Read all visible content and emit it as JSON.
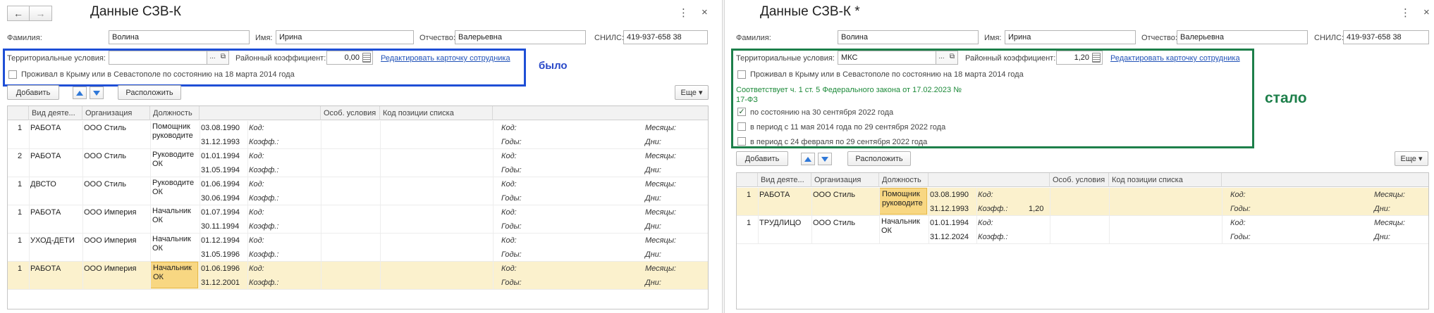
{
  "left": {
    "title": "Данные СЗВ-К",
    "fields": {
      "surname_label": "Фамилия:",
      "surname": "Волина",
      "name_label": "Имя:",
      "name": "Ирина",
      "patronymic_label": "Отчество:",
      "patronymic": "Валерьевна",
      "snils_label": "СНИЛС:",
      "snils": "419-937-658 38"
    },
    "territorial_label": "Территориальные условия:",
    "territorial_value": "",
    "district_label": "Районный коэффициент:",
    "district_value": "0,00",
    "edit_link": "Редактировать карточку сотрудника",
    "crimea_label": "Проживал в Крыму или в Севастополе по состоянию на 18 марта 2014 года",
    "annotation": "было",
    "toolbar": {
      "add": "Добавить",
      "arrange": "Расположить",
      "more": "Еще"
    },
    "columns": [
      "Вид деяте...",
      "Организация",
      "Должность",
      "Особ. условия",
      "Код позиции списка"
    ],
    "rows": [
      {
        "num": "1",
        "kind": "РАБОТА",
        "org": "ООО Стиль",
        "pos": "Помощник руководите",
        "d1": "03.08.1990",
        "d2": "31.12.1993",
        "coef": ""
      },
      {
        "num": "2",
        "kind": "РАБОТА",
        "org": "ООО Стиль",
        "pos": "Руководите ОК",
        "d1": "01.01.1994",
        "d2": "31.05.1994",
        "coef": ""
      },
      {
        "num": "1",
        "kind": "ДВСТО",
        "org": "ООО Стиль",
        "pos": "Руководите ОК",
        "d1": "01.06.1994",
        "d2": "30.06.1994",
        "coef": ""
      },
      {
        "num": "1",
        "kind": "РАБОТА",
        "org": "ООО Империя",
        "pos": "Начальник ОК",
        "d1": "01.07.1994",
        "d2": "30.11.1994",
        "coef": ""
      },
      {
        "num": "1",
        "kind": "УХОД-ДЕТИ",
        "org": "ООО Империя",
        "pos": "Начальник ОК",
        "d1": "01.12.1994",
        "d2": "31.05.1996",
        "coef": ""
      },
      {
        "num": "1",
        "kind": "РАБОТА",
        "org": "ООО Империя",
        "pos": "Начальник ОК",
        "d1": "01.06.1996",
        "d2": "31.12.2001",
        "coef": ""
      }
    ]
  },
  "right": {
    "title": "Данные СЗВ-К *",
    "fields": {
      "surname_label": "Фамилия:",
      "surname": "Волина",
      "name_label": "Имя:",
      "name": "Ирина",
      "patronymic_label": "Отчество:",
      "patronymic": "Валерьевна",
      "snils_label": "СНИЛС:",
      "snils": "419-937-658 38"
    },
    "territorial_label": "Территориальные условия:",
    "territorial_value": "МКС",
    "district_label": "Районный коэффициент:",
    "district_value": "1,20",
    "edit_link": "Редактировать карточку сотрудника",
    "crimea_label": "Проживал в Крыму или в Севастополе по состоянию на 18 марта 2014 года",
    "law_note_1": "Соответствует ч. 1 ст. 5 Федерального закона от 17.02.2023 №",
    "law_note_2": "17-ФЗ",
    "check_sep2022": "по состоянию на 30 сентября 2022 года",
    "check_may2014": "в период с 11 мая 2014 года по 29 сентября 2022 года",
    "check_feb2022": "в период с 24 февраля по 29 сентября 2022 года",
    "annotation": "стало",
    "toolbar": {
      "add": "Добавить",
      "arrange": "Расположить",
      "more": "Еще"
    },
    "columns": [
      "Вид деяте...",
      "Организация",
      "Должность",
      "Особ. условия",
      "Код позиции списка"
    ],
    "rows": [
      {
        "num": "1",
        "kind": "РАБОТА",
        "org": "ООО Стиль",
        "pos": "Помощник руководите",
        "d1": "03.08.1990",
        "d2": "31.12.1993",
        "coef": "1,20"
      },
      {
        "num": "1",
        "kind": "ТРУДЛИЦО",
        "org": "ООО Стиль",
        "pos": "Начальник ОК",
        "d1": "01.01.1994",
        "d2": "31.12.2024",
        "coef": ""
      }
    ]
  },
  "common": {
    "code_label": "Код:",
    "coef_label": "Коэфф.:",
    "years_label": "Годы:",
    "months_label": "Месяцы:",
    "days_label": "Дни:",
    "select_btn": "...",
    "check_mark": "✓",
    "more_arrow": "▾",
    "nav_back": "←",
    "nav_forward": "→",
    "menu_icon": "⋮",
    "close_icon": "×"
  },
  "colors": {
    "blue_frame": "#1f4fd6",
    "green_frame": "#1d7f4a",
    "selected_row": "#fbf1cd",
    "highlight_cell": "#f8d782"
  }
}
